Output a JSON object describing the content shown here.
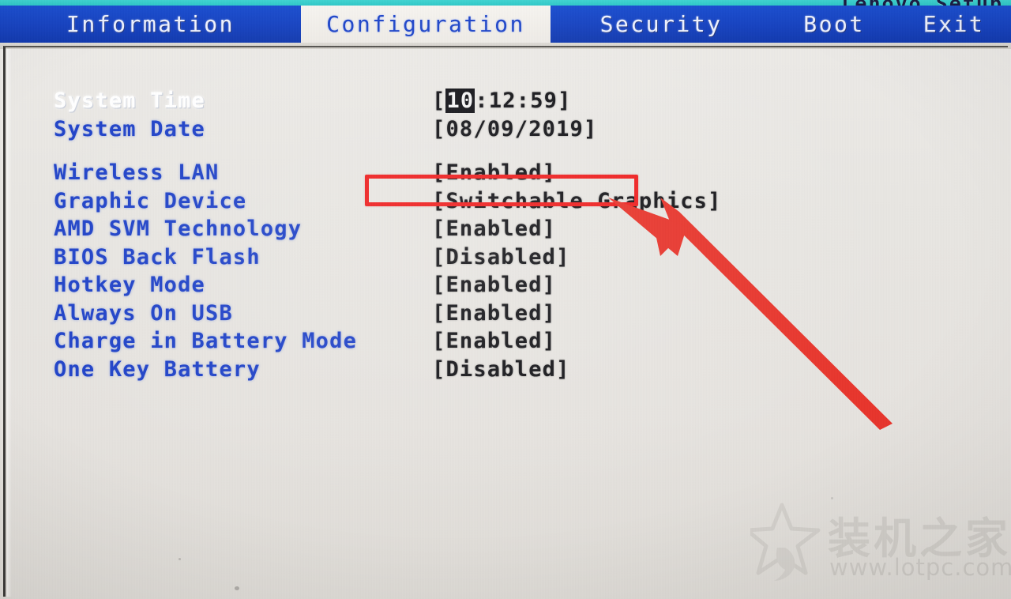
{
  "window": {
    "title": "Lenovo Setup"
  },
  "tabs": [
    {
      "id": "information",
      "label": "Information",
      "active": false
    },
    {
      "id": "configuration",
      "label": "Configuration",
      "active": true
    },
    {
      "id": "security",
      "label": "Security",
      "active": false
    },
    {
      "id": "boot",
      "label": "Boot",
      "active": false
    },
    {
      "id": "exit",
      "label": "Exit",
      "active": false
    }
  ],
  "settings": [
    {
      "label": "System Time",
      "value_prefix": "[",
      "value_highlight": "10",
      "value_suffix": ":12:59]",
      "selected": true
    },
    {
      "label": "System Date",
      "value": "[08/09/2019]",
      "selected": false
    },
    {
      "label": "Wireless LAN",
      "value": "[Enabled]",
      "selected": false
    },
    {
      "label": "Graphic Device",
      "value": "[Switchable Graphics]",
      "selected": false
    },
    {
      "label": "AMD SVM Technology",
      "value": "[Enabled]",
      "selected": false
    },
    {
      "label": "BIOS Back Flash",
      "value": "[Disabled]",
      "selected": false
    },
    {
      "label": "Hotkey Mode",
      "value": "[Enabled]",
      "selected": false
    },
    {
      "label": "Always On USB",
      "value": "[Enabled]",
      "selected": false
    },
    {
      "label": "Charge in Battery Mode",
      "value": "[Enabled]",
      "selected": false
    },
    {
      "label": "One Key Battery",
      "value": "[Disabled]",
      "selected": false
    }
  ],
  "annotation": {
    "highlight_target": "Wireless LAN value",
    "box_color": "#ef2020",
    "arrow_color": "#e8352c"
  },
  "watermark": {
    "brand_cn": "装机之家",
    "url": "www.lotpc.com"
  },
  "colors": {
    "tab_active_bg": "#f2efea",
    "tab_inactive_bg": "#1743c0",
    "label_blue": "#2043c8",
    "value_black": "#16161a",
    "screen_bg": "#e8e6e2",
    "cyan_strip": "#2fc8c8"
  }
}
